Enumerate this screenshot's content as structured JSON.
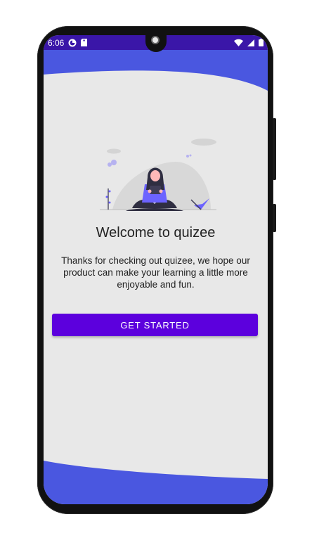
{
  "status_bar": {
    "time": "6:06",
    "icons_left": [
      "sync-icon",
      "sd-card-icon"
    ],
    "icons_right": [
      "wifi-icon",
      "signal-icon",
      "battery-icon"
    ],
    "color": "#3a16a8"
  },
  "welcome": {
    "title": "Welcome to quizee",
    "message": "Thanks for checking out quizee, we hope our product can make your learning a little more enjoyable and fun.",
    "button_label": "GET STARTED"
  },
  "colors": {
    "wave": "#4a57e0",
    "button": "#5c00dd",
    "background": "#e8e8e8",
    "illustration_accent": "#6c63ff"
  }
}
